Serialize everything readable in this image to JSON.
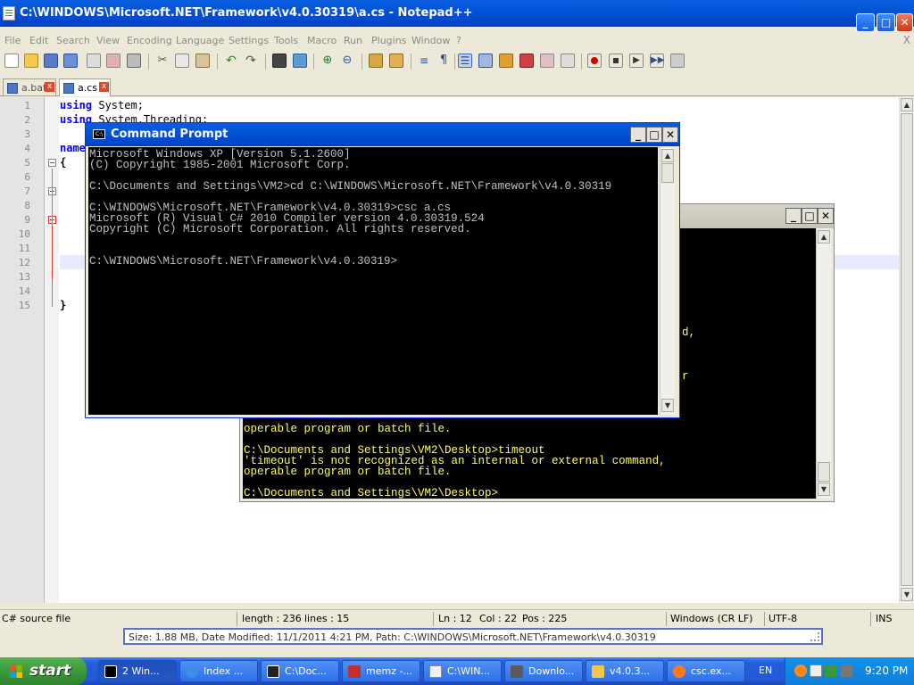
{
  "notepad": {
    "title": "C:\\WINDOWS\\Microsoft.NET\\Framework\\v4.0.30319\\a.cs - Notepad++",
    "menu": [
      "File",
      "Edit",
      "Search",
      "View",
      "Encoding",
      "Language",
      "Settings",
      "Tools",
      "Macro",
      "Run",
      "Plugins",
      "Window",
      "?"
    ],
    "menu_close": "X",
    "tabs": [
      {
        "label": "a.bat",
        "active": false
      },
      {
        "label": "a.cs",
        "active": true
      }
    ],
    "line_numbers": [
      "1",
      "2",
      "3",
      "4",
      "5",
      "6",
      "7",
      "8",
      "9",
      "10",
      "11",
      "12",
      "13",
      "14",
      "15"
    ],
    "code": [
      {
        "kw": "using",
        "rest": " System;"
      },
      {
        "kw": "using",
        "rest": " System.Threading;"
      },
      {
        "kw": "",
        "rest": ""
      },
      {
        "kw": "name",
        "rest": ""
      },
      {
        "kw": "",
        "rest": "{"
      },
      {
        "kw": "",
        "rest": ""
      },
      {
        "kw": "",
        "rest": ""
      },
      {
        "kw": "",
        "rest": ""
      },
      {
        "kw": "",
        "rest": ""
      },
      {
        "kw": "",
        "rest": ""
      },
      {
        "kw": "",
        "rest": ""
      },
      {
        "kw": "",
        "rest": ""
      },
      {
        "kw": "",
        "rest": ""
      },
      {
        "kw": "",
        "rest": ""
      },
      {
        "kw": "",
        "rest": "}"
      }
    ],
    "status": {
      "filetype": "C# source file",
      "length": "length : 236",
      "lines": "lines : 15",
      "ln": "Ln : 12",
      "col": "Col : 22",
      "pos": "Pos : 225",
      "eol": "Windows (CR LF)",
      "encoding": "UTF-8",
      "mode": "INS"
    }
  },
  "infobar": "Size: 1.88 MB, Date Modified: 11/1/2011 4:21 PM, Path: C:\\WINDOWS\\Microsoft.NET\\Framework\\v4.0.30319",
  "cmd_front": {
    "title": "Command Prompt",
    "lines": [
      "Microsoft Windows XP [Version 5.1.2600]",
      "(C) Copyright 1985-2001 Microsoft Corp.",
      "",
      "C:\\Documents and Settings\\VM2>cd C:\\WINDOWS\\Microsoft.NET\\Framework\\v4.0.30319",
      "",
      "C:\\WINDOWS\\Microsoft.NET\\Framework\\v4.0.30319>csc a.cs",
      "Microsoft (R) Visual C# 2010 Compiler version 4.0.30319.524",
      "Copyright (C) Microsoft Corporation. All rights reserved.",
      "",
      "",
      "C:\\WINDOWS\\Microsoft.NET\\Framework\\v4.0.30319>"
    ]
  },
  "cmd_back": {
    "visible_right_fragments": [
      {
        "text": "d,",
        "row": 0
      },
      {
        "text": "r",
        "row": 1
      }
    ],
    "lines": [
      "operable program or batch file.",
      "",
      "C:\\Documents and Settings\\VM2\\Desktop>timeout",
      "'timeout' is not recognized as an internal or external command,",
      "operable program or batch file.",
      "",
      "C:\\Documents and Settings\\VM2\\Desktop>"
    ]
  },
  "taskbar": {
    "start": "start",
    "tasks": [
      {
        "label": "2 Win...",
        "icon": "cmd-icon",
        "color": "#000000",
        "active": true
      },
      {
        "label": "Index ...",
        "icon": "ie-icon",
        "color": "#3a8ee6",
        "active": false
      },
      {
        "label": "C:\\Doc...",
        "icon": "7zip-icon",
        "color": "#222222",
        "active": false
      },
      {
        "label": "memz -...",
        "icon": "game-icon",
        "color": "#c03030",
        "active": false
      },
      {
        "label": "C:\\WIN...",
        "icon": "notepadpp-icon",
        "color": "#f0f0f0",
        "active": false
      },
      {
        "label": "Downlo...",
        "icon": "download-icon",
        "color": "#5a5a5a",
        "active": false
      },
      {
        "label": "v4.0.3...",
        "icon": "folder-icon",
        "color": "#f3c54a",
        "active": false
      },
      {
        "label": "csc.ex...",
        "icon": "search-icon",
        "color": "#ff7a1a",
        "active": false
      }
    ],
    "lang": "EN",
    "clock": "9:20 PM"
  }
}
